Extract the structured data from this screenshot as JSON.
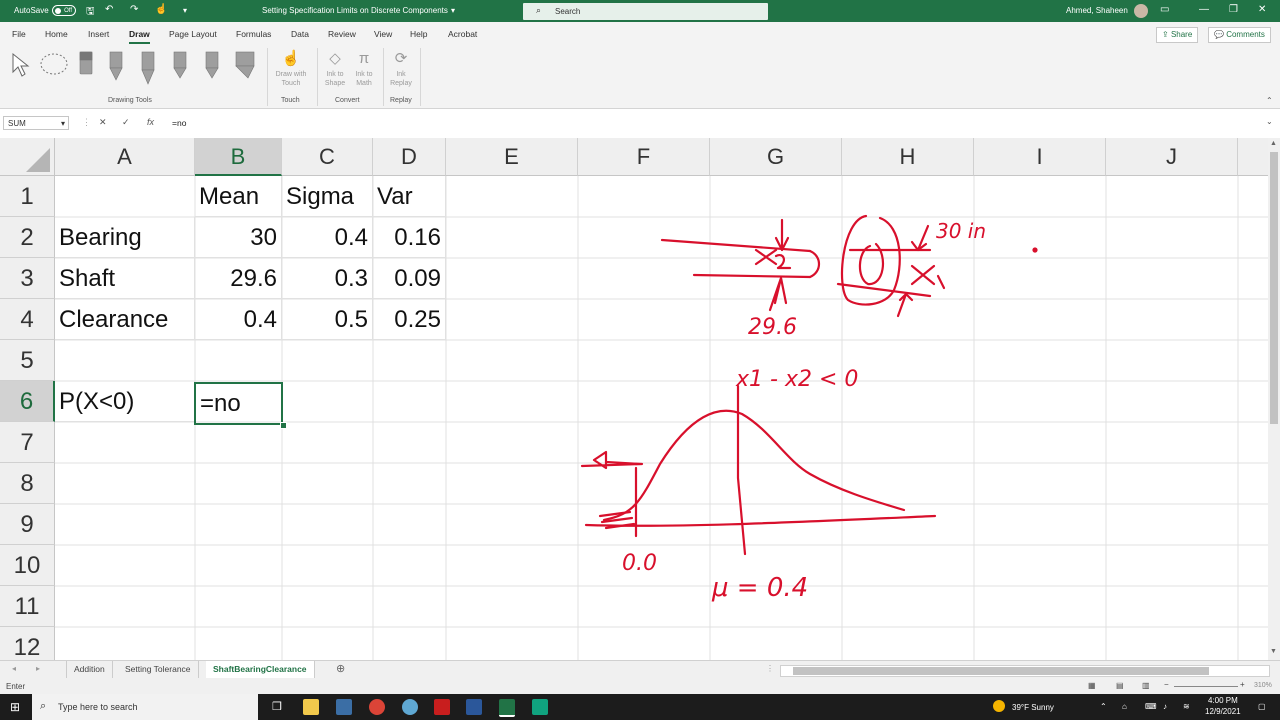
{
  "titlebar": {
    "autosave_label": "AutoSave",
    "autosave_state": "Off",
    "document_title": "Setting Specification Limits on Discrete Components",
    "search_placeholder": "Search",
    "user_name": "Ahmed, Shaheen"
  },
  "tabs": [
    "File",
    "Home",
    "Insert",
    "Draw",
    "Page Layout",
    "Formulas",
    "Data",
    "Review",
    "View",
    "Help",
    "Acrobat"
  ],
  "active_tab": "Draw",
  "share_label": "Share",
  "comments_label": "Comments",
  "ribbon": {
    "drawing_tools_label": "Drawing Tools",
    "draw_with_touch": [
      "Draw with",
      "Touch"
    ],
    "touch_group": "Touch",
    "ink_to_shape": [
      "Ink to",
      "Shape"
    ],
    "ink_to_math": [
      "Ink to",
      "Math"
    ],
    "convert_group": "Convert",
    "ink_replay": [
      "Ink",
      "Replay"
    ],
    "replay_group": "Replay",
    "pen_colors": [
      "#9e9e9e",
      "#9e9e9e",
      "#9e9e9e",
      "#9e9e9e",
      "#9e9e9e",
      "#9e9e9e",
      "#9e9e9e"
    ]
  },
  "formula_bar": {
    "name_box": "SUM",
    "content": "=no"
  },
  "columns": [
    "A",
    "B",
    "C",
    "D",
    "E",
    "F",
    "G",
    "H",
    "I",
    "J"
  ],
  "rows": [
    "1",
    "2",
    "3",
    "4",
    "5",
    "6",
    "7",
    "8",
    "9",
    "10",
    "11",
    "12"
  ],
  "cells": {
    "B1": "Mean",
    "C1": "Sigma",
    "D1": "Var",
    "A2": "Bearing",
    "B2": "30",
    "C2": "0.4",
    "D2": "0.16",
    "A3": "Shaft",
    "B3": "29.6",
    "C3": "0.3",
    "D3": "0.09",
    "A4": "Clearance",
    "B4": "0.4",
    "C4": "0.5",
    "D4": "0.25",
    "A6": "P(X<0)",
    "B6": "=no"
  },
  "sheets": [
    "Addition",
    "Setting Tolerance",
    "ShaftBearingClearance"
  ],
  "active_sheet": "ShaftBearingClearance",
  "status": {
    "mode": "Enter",
    "zoom": "310%"
  },
  "ink_annotations": {
    "label_1": "29.6",
    "label_2": "30 in",
    "label_3": "x1 - x2 < 0",
    "label_4": "0.0",
    "label_5": "μ = 0.4",
    "color": "#d8102c"
  },
  "taskbar": {
    "search_placeholder": "Type here to search",
    "weather": "39°F  Sunny",
    "time": "4:00 PM",
    "date": "12/9/2021"
  },
  "colors": {
    "excel_green": "#217346",
    "ink_red": "#d8102c"
  }
}
